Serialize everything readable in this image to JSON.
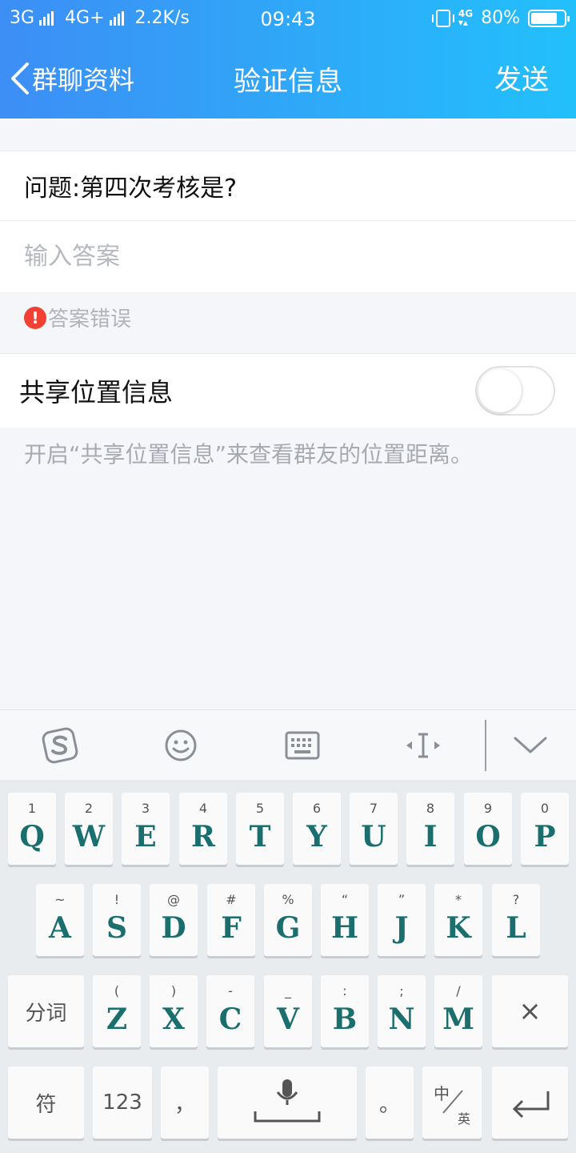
{
  "status_bar": {
    "network1": "3G",
    "network2": "4G+",
    "speed": "2.2K/s",
    "time": "09:43",
    "lte_badge": "4G",
    "battery_percent": "80%",
    "battery_level": 0.8
  },
  "navbar": {
    "back_label": "群聊资料",
    "title": "验证信息",
    "send_label": "发送"
  },
  "form": {
    "question": "问题:第四次考核是?",
    "answer_placeholder": "输入答案",
    "answer_value": "",
    "error_text": "答案错误",
    "error_icon_glyph": "!",
    "share_label": "共享位置信息",
    "share_enabled": false,
    "share_hint": "开启“共享位置信息”来查看群友的位置距离。"
  },
  "keyboard_toolbar": {
    "icons": [
      "sogou-logo-icon",
      "emoji-icon",
      "keyboard-icon",
      "cursor-icon",
      "collapse-icon"
    ]
  },
  "keyboard": {
    "row1": [
      {
        "hint": "1",
        "key": "Q"
      },
      {
        "hint": "2",
        "key": "W"
      },
      {
        "hint": "3",
        "key": "E"
      },
      {
        "hint": "4",
        "key": "R"
      },
      {
        "hint": "5",
        "key": "T"
      },
      {
        "hint": "6",
        "key": "Y"
      },
      {
        "hint": "7",
        "key": "U"
      },
      {
        "hint": "8",
        "key": "I"
      },
      {
        "hint": "9",
        "key": "O"
      },
      {
        "hint": "0",
        "key": "P"
      }
    ],
    "row2": [
      {
        "hint": "~",
        "key": "A"
      },
      {
        "hint": "!",
        "key": "S"
      },
      {
        "hint": "@",
        "key": "D"
      },
      {
        "hint": "#",
        "key": "F"
      },
      {
        "hint": "%",
        "key": "G"
      },
      {
        "hint": "“",
        "key": "H"
      },
      {
        "hint": "”",
        "key": "J"
      },
      {
        "hint": "*",
        "key": "K"
      },
      {
        "hint": "?",
        "key": "L"
      }
    ],
    "row3": [
      {
        "hint": "(",
        "key": "Z"
      },
      {
        "hint": ")",
        "key": "X"
      },
      {
        "hint": "-",
        "key": "C"
      },
      {
        "hint": "_",
        "key": "V"
      },
      {
        "hint": ":",
        "key": "B"
      },
      {
        "hint": ";",
        "key": "N"
      },
      {
        "hint": "/",
        "key": "M"
      }
    ],
    "segment_label": "分词",
    "delete_glyph": "×",
    "symbol_label": "符",
    "number_label": "123",
    "comma_label": "，",
    "period_label": "。",
    "lang_top": "中",
    "lang_bottom": "英"
  }
}
